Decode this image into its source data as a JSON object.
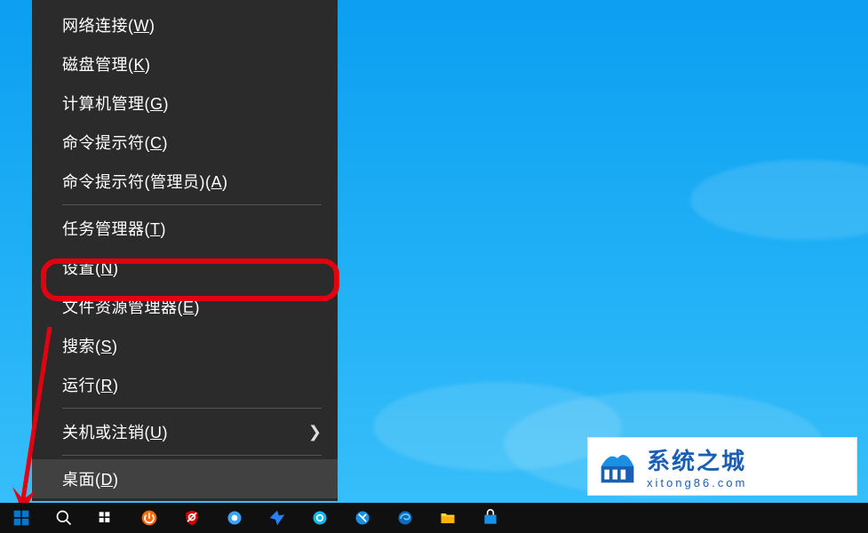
{
  "menu": {
    "items": [
      {
        "label": "网络连接",
        "mnemonic": "W"
      },
      {
        "label": "磁盘管理",
        "mnemonic": "K"
      },
      {
        "label": "计算机管理",
        "mnemonic": "G"
      },
      {
        "label": "命令提示符",
        "mnemonic": "C"
      },
      {
        "label": "命令提示符(管理员)",
        "mnemonic": "A"
      },
      {
        "separator": true
      },
      {
        "label": "任务管理器",
        "mnemonic": "T"
      },
      {
        "label": "设置",
        "mnemonic": "N",
        "highlighted": true
      },
      {
        "label": "文件资源管理器",
        "mnemonic": "E"
      },
      {
        "label": "搜索",
        "mnemonic": "S"
      },
      {
        "label": "运行",
        "mnemonic": "R"
      },
      {
        "separator": true
      },
      {
        "label": "关机或注销",
        "mnemonic": "U",
        "has_submenu": true
      },
      {
        "separator": true
      },
      {
        "label": "桌面",
        "mnemonic": "D",
        "hover": true
      }
    ]
  },
  "watermark": {
    "title": "系统之城",
    "url": "xitong86.com"
  },
  "taskbar": {
    "icons": [
      "start",
      "search",
      "taskview",
      "power",
      "shield",
      "drive",
      "bird",
      "qq",
      "globe",
      "edge",
      "files",
      "store"
    ]
  }
}
